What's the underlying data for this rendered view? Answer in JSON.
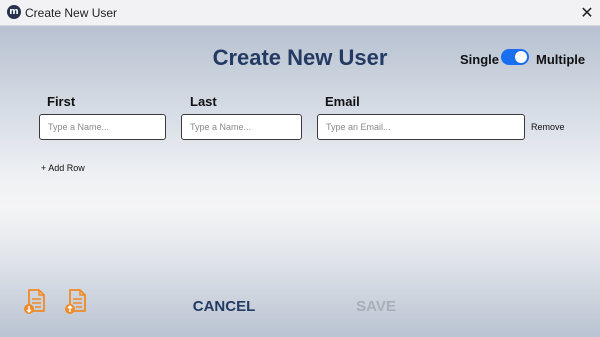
{
  "window": {
    "title": "Create New User",
    "app_icon_glyph": "m"
  },
  "header": {
    "title": "Create New User"
  },
  "mode_toggle": {
    "left_label": "Single",
    "right_label": "Multiple",
    "selected": "Multiple",
    "accent_color": "#1a6ef0"
  },
  "columns": {
    "first": "First",
    "last": "Last",
    "email": "Email"
  },
  "row": {
    "first_placeholder": "Type a Name...",
    "last_placeholder": "Type a Name...",
    "email_placeholder": "Type an Email...",
    "remove_label": "Remove"
  },
  "add_row_label": "+ Add Row",
  "footer": {
    "cancel_label": "CANCEL",
    "save_label": "SAVE"
  },
  "icons": {
    "doc_icon_color": "#f08a24"
  }
}
